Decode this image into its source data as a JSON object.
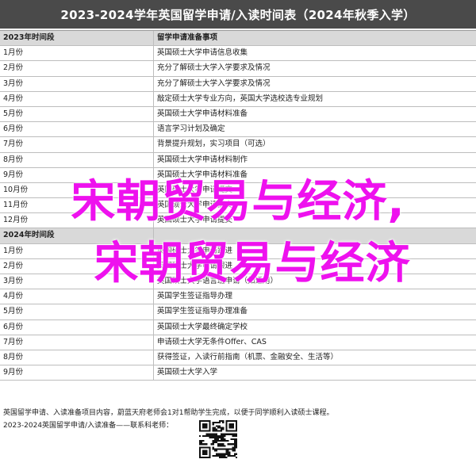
{
  "title": "2023-2024学年英国留学申请/入读时间表（2024年秋季入学）",
  "headers": {
    "period": "2023年时间段",
    "items": "留学申请准备事项"
  },
  "rows": [
    {
      "period": "1月份",
      "item": "英国硕士大学申请信息收集"
    },
    {
      "period": "2月份",
      "item": "充分了解硕士大学入学要求及情况"
    },
    {
      "period": "3月份",
      "item": "充分了解硕士大学入学要求及情况"
    },
    {
      "period": "4月份",
      "item": "敲定硕士大学专业方向，英国大学选校选专业规划"
    },
    {
      "period": "5月份",
      "item": "英国硕士大学申请材料准备"
    },
    {
      "period": "6月份",
      "item": "语言学习计划及确定"
    },
    {
      "period": "7月份",
      "item": "背景提升规划，实习项目（可选）"
    },
    {
      "period": "8月份",
      "item": "英国硕士大学申请材料制作"
    },
    {
      "period": "9月份",
      "item": "英国硕士大学申请材料准备"
    },
    {
      "period": "10月份",
      "item": "英国硕士大学申请提交"
    },
    {
      "period": "11月份",
      "item": "英国硕士大学申请提交"
    },
    {
      "period": "12月份",
      "item": "英国硕士大学申请提交"
    },
    {
      "period": "2024年时间段",
      "item": "",
      "year": true
    },
    {
      "period": "1月份",
      "item": "英国硕士大学申请跟进"
    },
    {
      "period": "2月份",
      "item": "英国硕士大学申请跟进"
    },
    {
      "period": "3月份",
      "item": "英国硕士大学语言班申请（如适用）"
    },
    {
      "period": "4月份",
      "item": "英国学生签证指导办理"
    },
    {
      "period": "5月份",
      "item": "英国学生签证指导办理准备"
    },
    {
      "period": "6月份",
      "item": "英国硕士大学最终确定学校"
    },
    {
      "period": "7月份",
      "item": "申请硕士大学无条件Offer、CAS"
    },
    {
      "period": "8月份",
      "item": "获得签证，入读行前指南（机票、金融安全、生活等）"
    },
    {
      "period": "9月份",
      "item": "英国硕士大学入学"
    }
  ],
  "footer": {
    "line1": "英国留学申请、入读准备项目内容，蔚蓝天府老师会1对1帮助学生完成，以便于同学顺利入读硕士课程。",
    "line2": "2023-2024英国留学申请/入读准备——联系科老师："
  },
  "overlay": {
    "line1": "宋朝贸易与经济,",
    "line2": "宋朝贸易与经济"
  },
  "colors": {
    "title_bg": "#4a4a4a",
    "header_bg": "#d9d9d9",
    "overlay_text": "#ee11ee"
  }
}
